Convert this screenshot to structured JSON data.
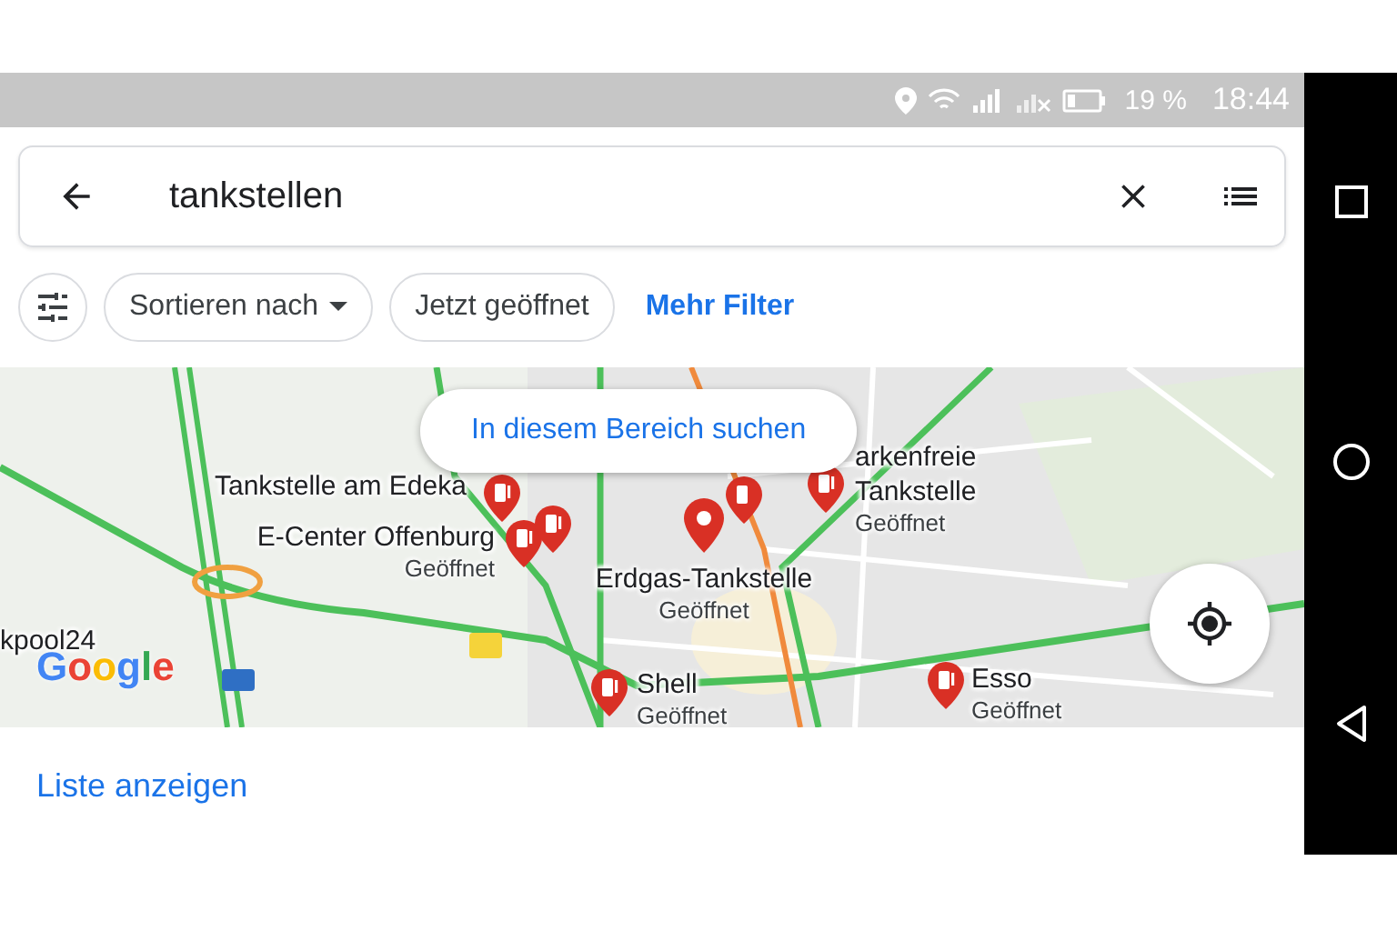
{
  "status_bar": {
    "battery": "19 %",
    "time": "18:44"
  },
  "search": {
    "value": "tankstellen"
  },
  "filters": [
    {
      "label": "Sortieren nach",
      "kind": "dropdown"
    },
    {
      "label": "Jetzt geöffnet",
      "kind": "chip"
    },
    {
      "label": "Mehr Filter",
      "kind": "link"
    }
  ],
  "map": {
    "search_area_button": "In diesem Bereich suchen",
    "logo": "Google",
    "places": [
      {
        "kind": "fuel",
        "lines": [
          "Tankstelle am Edeka"
        ]
      },
      {
        "kind": "fuel",
        "lines": [
          "E-Center Offenburg"
        ],
        "status": "Geöffnet"
      },
      {
        "kind": "plain",
        "lines": [
          "Erdgas-Tankstelle"
        ],
        "status": "Geöffnet"
      },
      {
        "kind": "fuel",
        "lines": [
          "arkenfreie",
          "Tankstelle"
        ],
        "status": "Geöffnet"
      },
      {
        "kind": "fuel",
        "lines": [
          "Shell"
        ],
        "status": "Geöffnet"
      },
      {
        "kind": "fuel",
        "lines": [
          "Esso"
        ],
        "status": "Geöffnet"
      },
      {
        "kind": "none",
        "lines": [
          "kpool24"
        ]
      }
    ]
  },
  "list_button": "Liste anzeigen"
}
